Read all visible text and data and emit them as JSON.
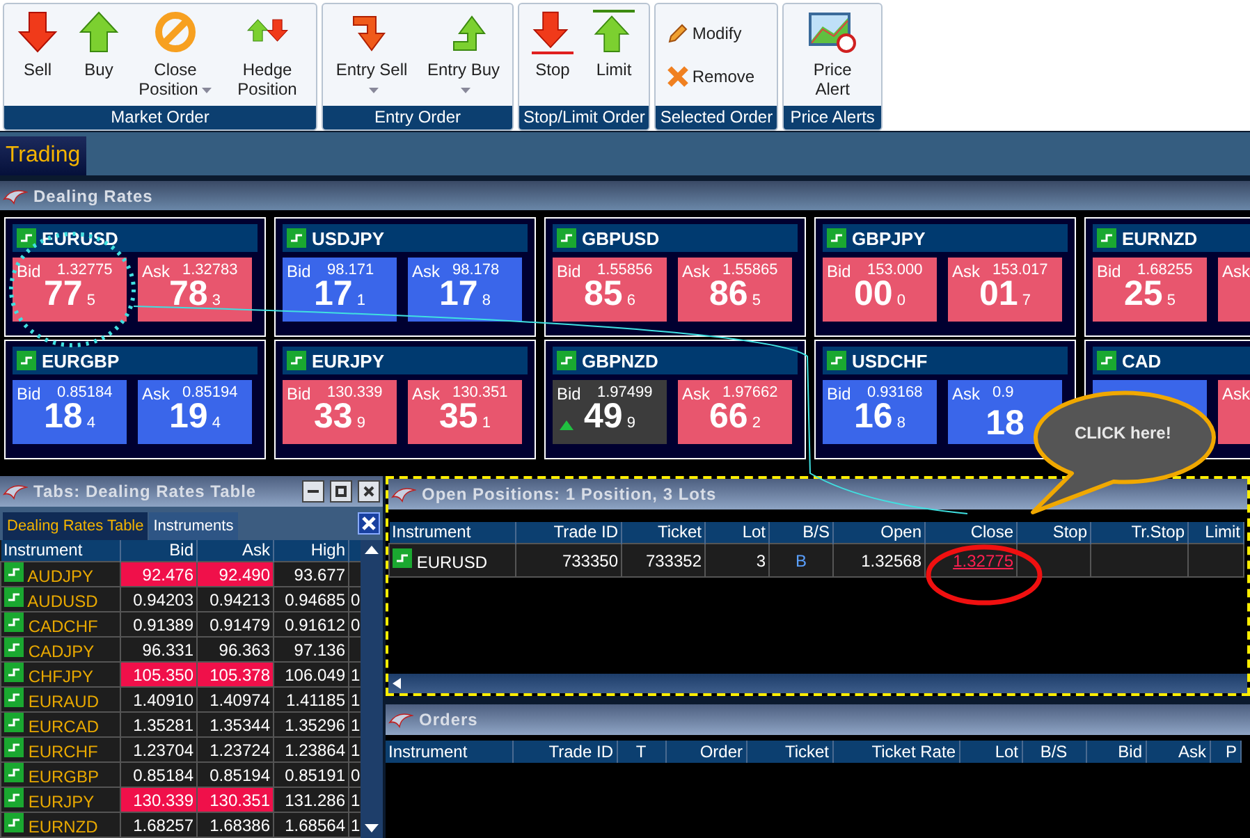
{
  "toolbar": {
    "groups": [
      {
        "label": "Market Order",
        "kind": "large",
        "buttons": [
          {
            "kind": "sell",
            "label": "Sell",
            "has_menu": false
          },
          {
            "kind": "buy",
            "label": "Buy",
            "has_menu": false
          },
          {
            "kind": "close",
            "label": "Close Position",
            "has_menu": true
          },
          {
            "kind": "hedge",
            "label": "Hedge Position",
            "has_menu": false
          }
        ]
      },
      {
        "label": "Entry Order",
        "kind": "large",
        "buttons": [
          {
            "kind": "entry_sell",
            "label": "Entry Sell",
            "has_menu": true
          },
          {
            "kind": "entry_buy",
            "label": "Entry Buy",
            "has_menu": true
          }
        ]
      },
      {
        "label": "Stop/Limit Order",
        "kind": "large",
        "buttons": [
          {
            "kind": "stop",
            "label": "Stop",
            "has_menu": false
          },
          {
            "kind": "limit",
            "label": "Limit",
            "has_menu": false
          }
        ]
      },
      {
        "label": "Selected Order",
        "kind": "small",
        "buttons": [
          {
            "kind": "modify",
            "label": "Modify",
            "has_menu": false
          },
          {
            "kind": "remove",
            "label": "Remove",
            "has_menu": false
          }
        ]
      },
      {
        "label": "Price Alerts",
        "kind": "large",
        "buttons": [
          {
            "kind": "alert",
            "label": "Price Alert",
            "has_menu": false
          }
        ]
      }
    ]
  },
  "tabs": [
    {
      "label": "Trading",
      "selected": true
    }
  ],
  "dealing_rates": {
    "title": "Dealing Rates",
    "tiles": [
      {
        "symbol": "EURUSD",
        "bid": {
          "label": "Bid",
          "price": "1.32775",
          "big": "77",
          "pip": "5",
          "color": "#e8566e"
        },
        "ask": {
          "label": "Ask",
          "price": "1.32783",
          "big": "78",
          "pip": "3",
          "color": "#e8566e"
        }
      },
      {
        "symbol": "USDJPY",
        "bid": {
          "label": "Bid",
          "price": "98.171",
          "big": "17",
          "pip": "1",
          "color": "#3a66ea"
        },
        "ask": {
          "label": "Ask",
          "price": "98.178",
          "big": "17",
          "pip": "8",
          "color": "#3a66ea"
        }
      },
      {
        "symbol": "GBPUSD",
        "bid": {
          "label": "Bid",
          "price": "1.55856",
          "big": "85",
          "pip": "6",
          "color": "#e8566e"
        },
        "ask": {
          "label": "Ask",
          "price": "1.55865",
          "big": "86",
          "pip": "5",
          "color": "#e8566e"
        }
      },
      {
        "symbol": "GBPJPY",
        "bid": {
          "label": "Bid",
          "price": "153.000",
          "big": "00",
          "pip": "0",
          "color": "#e8566e"
        },
        "ask": {
          "label": "Ask",
          "price": "153.017",
          "big": "01",
          "pip": "7",
          "color": "#e8566e"
        }
      },
      {
        "symbol": "EURNZD",
        "bid": {
          "label": "Bid",
          "price": "1.68255",
          "big": "25",
          "pip": "5",
          "color": "#e8566e"
        },
        "ask": {
          "label": "Ask",
          "color": "#e8566e"
        }
      },
      {
        "symbol": "EURGBP",
        "bid": {
          "label": "Bid",
          "price": "0.85184",
          "big": "18",
          "pip": "4",
          "color": "#3a66ea"
        },
        "ask": {
          "label": "Ask",
          "price": "0.85194",
          "big": "19",
          "pip": "4",
          "color": "#3a66ea"
        }
      },
      {
        "symbol": "EURJPY",
        "bid": {
          "label": "Bid",
          "price": "130.339",
          "big": "33",
          "pip": "9",
          "color": "#e8566e"
        },
        "ask": {
          "label": "Ask",
          "price": "130.351",
          "big": "35",
          "pip": "1",
          "color": "#e8566e"
        }
      },
      {
        "symbol": "GBPNZD",
        "bid": {
          "label": "Bid",
          "price": "1.97499",
          "big": "49",
          "pip": "9",
          "color": "#3c3c3c",
          "up_tick": true
        },
        "ask": {
          "label": "Ask",
          "price": "1.97662",
          "big": "66",
          "pip": "2",
          "color": "#e8566e"
        }
      },
      {
        "symbol": "USDCHF",
        "bid": {
          "label": "Bid",
          "price": "0.93168",
          "big": "16",
          "pip": "8",
          "color": "#3a66ea"
        },
        "ask": {
          "label": "Ask",
          "price": "0.9",
          "big": "18",
          "color": "#3a66ea"
        }
      },
      {
        "symbol": "CAD",
        "bid": {
          "color": "#3a66ea"
        },
        "ask": {
          "label": "Ask",
          "color": "#e8566e"
        }
      }
    ]
  },
  "rates_table": {
    "title": "Tabs: Dealing Rates Table",
    "tabs": [
      {
        "label": "Dealing Rates Table",
        "selected": true
      },
      {
        "label": "Instruments",
        "selected": false
      }
    ],
    "columns": [
      "Instrument",
      "Bid",
      "Ask",
      "High"
    ],
    "rows": [
      {
        "instrument": "AUDJPY",
        "bid": "92.476",
        "ask": "92.490",
        "high": "93.677",
        "highlighted": true
      },
      {
        "instrument": "AUDUSD",
        "bid": "0.94203",
        "ask": "0.94213",
        "high": "0.94685",
        "column_5": "0",
        "highlighted": false
      },
      {
        "instrument": "CADCHF",
        "bid": "0.91389",
        "ask": "0.91479",
        "high": "0.91612",
        "column_5": "0",
        "highlighted": false
      },
      {
        "instrument": "CADJPY",
        "bid": "96.331",
        "ask": "96.363",
        "high": "97.136",
        "highlighted": false
      },
      {
        "instrument": "CHFJPY",
        "bid": "105.350",
        "ask": "105.378",
        "high": "106.049",
        "column_5": "1",
        "highlighted": true
      },
      {
        "instrument": "EURAUD",
        "bid": "1.40910",
        "ask": "1.40974",
        "high": "1.41185",
        "column_5": "1",
        "highlighted": false
      },
      {
        "instrument": "EURCAD",
        "bid": "1.35281",
        "ask": "1.35344",
        "high": "1.35296",
        "column_5": "1",
        "highlighted": false
      },
      {
        "instrument": "EURCHF",
        "bid": "1.23704",
        "ask": "1.23724",
        "high": "1.23864",
        "column_5": "1",
        "highlighted": false
      },
      {
        "instrument": "EURGBP",
        "bid": "0.85184",
        "ask": "0.85194",
        "high": "0.85191",
        "column_5": "0",
        "highlighted": false
      },
      {
        "instrument": "EURJPY",
        "bid": "130.339",
        "ask": "130.351",
        "high": "131.286",
        "column_5": "1",
        "highlighted": true
      },
      {
        "instrument": "EURNZD",
        "bid": "1.68257",
        "ask": "1.68386",
        "high": "1.68564",
        "column_5": "1",
        "highlighted": false
      }
    ]
  },
  "open_positions": {
    "title": "Open Positions: 1 Position, 3 Lots",
    "highlighted": true,
    "columns": [
      "Instrument",
      "Trade ID",
      "Ticket",
      "Lot",
      "B/S",
      "Open",
      "Close",
      "Stop",
      "Tr.Stop",
      "Limit"
    ],
    "rows": [
      {
        "cells": [
          "EURUSD",
          "733350",
          "733352",
          "3",
          "B",
          "1.32568",
          "1.32775",
          "",
          "",
          ""
        ]
      }
    ]
  },
  "orders": {
    "title": "Orders",
    "columns": [
      "Instrument",
      "Trade ID",
      "T",
      "Order",
      "Ticket",
      "Ticket Rate",
      "Lot",
      "B/S",
      "Bid",
      "Ask",
      "P"
    ]
  },
  "callout": {
    "text": "CLICK here!"
  }
}
